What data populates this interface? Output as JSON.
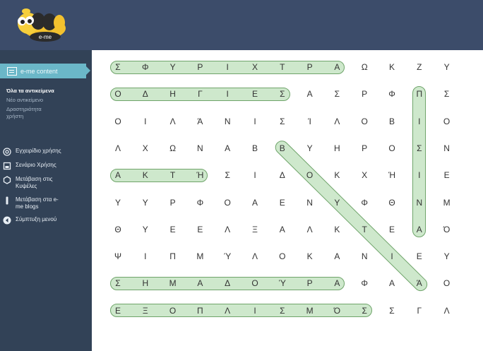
{
  "header": {
    "logo_text": "e-me"
  },
  "sidebar": {
    "active_item": "e-me content",
    "sub_items": [
      "Όλα τα αντικείμενα",
      "Νέο αντικείμενο",
      "Δραστηριότητα",
      "χρήστη"
    ],
    "menu": [
      {
        "icon": "help-icon",
        "label1": "Εγχειρίδιο χρήσης",
        "label2": ""
      },
      {
        "icon": "document-icon",
        "label1": "Σενάριο Χρήσης",
        "label2": ""
      },
      {
        "icon": "hexagon-icon",
        "label1": "Μετάβαση στις",
        "label2": "Κυψέλες"
      },
      {
        "icon": "blog-icon",
        "label1": "Μετάβαση στα e-",
        "label2": "me blogs"
      },
      {
        "icon": "collapse-icon",
        "label1": "Σύμπτυξη μενού",
        "label2": ""
      }
    ]
  },
  "puzzle": {
    "rows": [
      [
        "Σ",
        "Φ",
        "Υ",
        "Ρ",
        "Ι",
        "Χ",
        "Τ",
        "Ρ",
        "Α",
        "Ω",
        "Κ",
        "Ζ",
        "Υ"
      ],
      [
        "Ο",
        "Δ",
        "Η",
        "Γ",
        "Ι",
        "Ε",
        "Σ",
        "Α",
        "Σ",
        "Ρ",
        "Φ",
        "Π",
        "Σ"
      ],
      [
        "Ο",
        "Ι",
        "Λ",
        "Ά",
        "Ν",
        "Ι",
        "Σ",
        "Ί",
        "Λ",
        "Ο",
        "Β",
        "Ι",
        "Ο"
      ],
      [
        "Λ",
        "Χ",
        "Ω",
        "Ν",
        "Α",
        "Β",
        "Β",
        "Υ",
        "Η",
        "Ρ",
        "Ο",
        "Σ",
        "Ν"
      ],
      [
        "Α",
        "Κ",
        "Τ",
        "Ή",
        "Σ",
        "Ι",
        "Δ",
        "Ο",
        "Κ",
        "Χ",
        "Ή",
        "Ι",
        "Ε"
      ],
      [
        "Υ",
        "Υ",
        "Ρ",
        "Φ",
        "Ο",
        "Α",
        "Ε",
        "Ν",
        "Υ",
        "Φ",
        "Θ",
        "Ν",
        "Μ"
      ],
      [
        "Θ",
        "Υ",
        "Ε",
        "Ε",
        "Λ",
        "Ξ",
        "Α",
        "Λ",
        "Κ",
        "Τ",
        "Ε",
        "Α",
        "Ό"
      ],
      [
        "Ψ",
        "Ι",
        "Π",
        "Μ",
        "Ύ",
        "Λ",
        "Ο",
        "Κ",
        "Α",
        "Ν",
        "Ι",
        "Ε",
        "Υ"
      ],
      [
        "Σ",
        "Η",
        "Μ",
        "Α",
        "Δ",
        "Ο",
        "Ύ",
        "Ρ",
        "Α",
        "Φ",
        "Α",
        "Ά",
        "Ο"
      ],
      [
        "Ε",
        "Ξ",
        "Ο",
        "Π",
        "Λ",
        "Ι",
        "Σ",
        "Μ",
        "Ό",
        "Σ",
        "Σ",
        "Γ",
        "Λ"
      ]
    ],
    "found_words": [
      {
        "row": 0,
        "col_start": 0,
        "col_end": 8,
        "dir": "h"
      },
      {
        "row": 1,
        "col_start": 0,
        "col_end": 6,
        "dir": "h"
      },
      {
        "row": 4,
        "col_start": 0,
        "col_end": 3,
        "dir": "h"
      },
      {
        "row": 8,
        "col_start": 0,
        "col_end": 8,
        "dir": "h"
      },
      {
        "row": 9,
        "col_start": 0,
        "col_end": 9,
        "dir": "h"
      },
      {
        "col": 11,
        "row_start": 1,
        "row_end": 6,
        "dir": "v"
      },
      {
        "row_start": 3,
        "col_start": 6,
        "row_end": 8,
        "col_end": 11,
        "dir": "d"
      }
    ]
  },
  "colors": {
    "topbar": "#3c4c6a",
    "sidebar": "#324257",
    "active": "#6bb7c8",
    "highlight": "#a6d6a2"
  }
}
